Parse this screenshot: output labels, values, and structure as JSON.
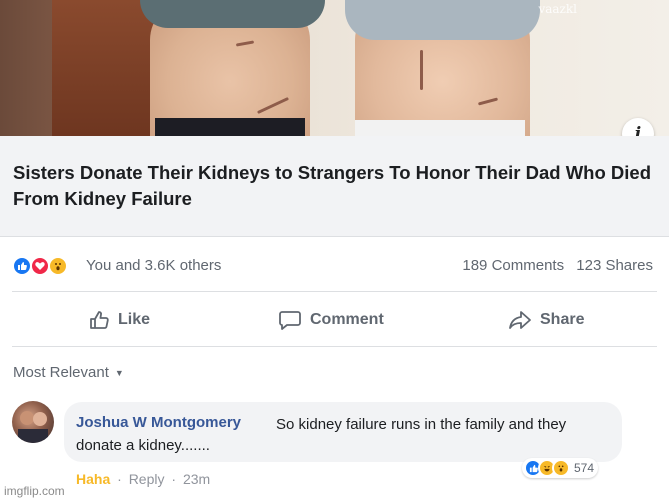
{
  "post": {
    "photo_watermark": "vaazkl",
    "headline": "Sisters Donate Their Kidneys to Strangers To Honor Their Dad Who Died From Kidney Failure",
    "info_icon": "i"
  },
  "reactions": {
    "text": "You and 3.6K others",
    "comments": "189 Comments",
    "shares": "123 Shares",
    "icons": [
      "like-icon",
      "love-icon",
      "wow-icon"
    ]
  },
  "actions": {
    "like": "Like",
    "comment": "Comment",
    "share": "Share"
  },
  "sort": {
    "label": "Most Relevant"
  },
  "comment": {
    "author": "Joshua W Montgomery",
    "text": "So kidney failure runs in the family and they donate a kidney.......",
    "reaction_label": "Haha",
    "reply_label": "Reply",
    "time": "23m",
    "reaction_count": "574"
  },
  "footer": {
    "watermark": "imgflip.com"
  },
  "colors": {
    "link": "#385898",
    "like": "#1877f2",
    "love": "#f02849",
    "wow": "#f7b928"
  }
}
